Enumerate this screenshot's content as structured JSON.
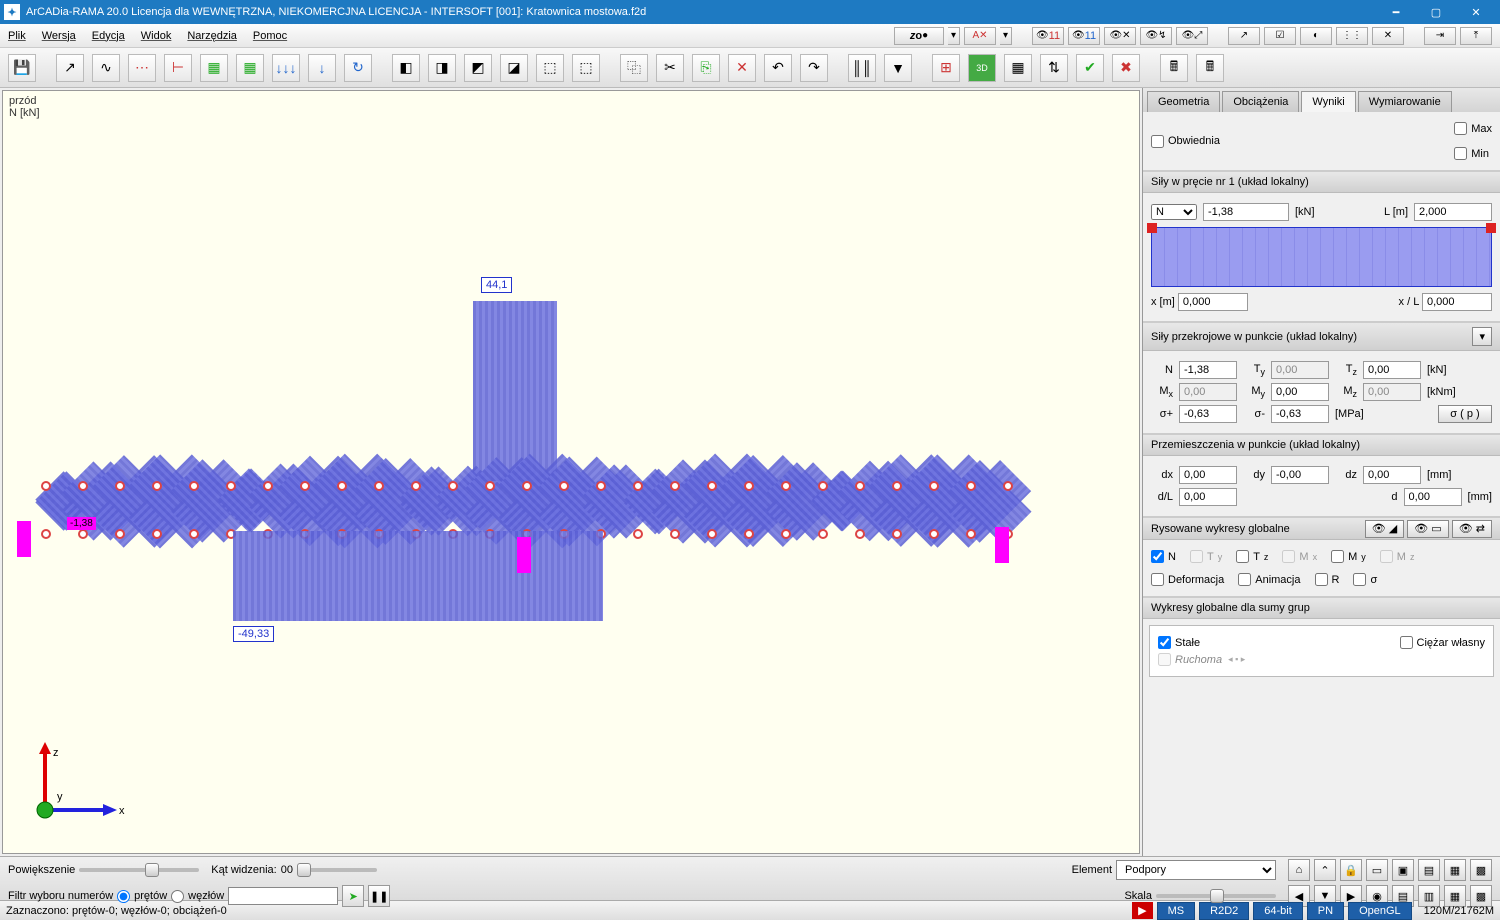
{
  "title": "ArCADia-RAMA 20.0 Licencja dla WEWNĘTRZNA, NIEKOMERCJNA LICENCJA - INTERSOFT [001]: Kratownica mostowa.f2d",
  "menu": [
    "Plik",
    "Wersja",
    "Edycja",
    "Widok",
    "Narzędzia",
    "Pomoc"
  ],
  "canvas": {
    "corner": "przód",
    "unit": "N [kN]",
    "val_top": "44,1",
    "val_bot": "-49,33",
    "val_sel": "-1,38",
    "axis_x": "x",
    "axis_y": "y",
    "axis_z": "z"
  },
  "tabs": {
    "geom": "Geometria",
    "loads": "Obciążenia",
    "results": "Wyniki",
    "dim": "Wymiarowanie"
  },
  "env": {
    "label": "Obwiednia",
    "max": "Max",
    "min": "Min"
  },
  "sec_forces": {
    "title": "Siły w pręcie nr 1 (układ lokalny)",
    "force_sel": "N",
    "force_val": "-1,38",
    "force_unit": "[kN]",
    "L_lbl": "L [m]",
    "L_val": "2,000",
    "x_lbl": "x [m]",
    "x_val": "0,000",
    "xL_lbl": "x / L",
    "xL_val": "0,000"
  },
  "sec_point": {
    "title": "Siły przekrojowe w punkcie (układ lokalny)",
    "N": "-1,38",
    "Ty": "0,00",
    "Tz": "0,00",
    "Mx": "0,00",
    "My": "0,00",
    "Mz": "0,00",
    "sp": "-0,63",
    "sm": "-0,63",
    "u_kN": "[kN]",
    "u_kNm": "[kNm]",
    "u_MPa": "[MPa]",
    "btn": "σ ( p )"
  },
  "sec_disp": {
    "title": "Przemieszczenia w punkcie (układ lokalny)",
    "dx": "0,00",
    "dy": "-0,00",
    "dz": "0,00",
    "dL": "0,00",
    "d": "0,00",
    "u": "[mm]"
  },
  "sec_diag": {
    "title": "Rysowane wykresy globalne",
    "N": "N",
    "Ty": "Ty",
    "Tz": "Tz",
    "Mx": "Mx",
    "My": "My",
    "Mz": "Mz",
    "def": "Deformacja",
    "anim": "Animacja",
    "R": "R",
    "sig": "σ"
  },
  "sec_global": {
    "title": "Wykresy globalne dla sumy grup",
    "stale": "Stałe",
    "ciezar": "Ciężar własny",
    "ruchoma": "Ruchoma"
  },
  "bottom": {
    "zoom": "Powiększenie",
    "fov_lbl": "Kąt widzenia:",
    "fov_val": "00",
    "filter": "Filtr wyboru numerów",
    "bars": "prętów",
    "nodes": "węzłów",
    "elem": "Element",
    "elem_val": "Podpory",
    "scale": "Skala"
  },
  "status": {
    "sel": "Zaznaczono: prętów-0; węzłów-0; obciążeń-0",
    "ms": "MS",
    "r2": "R2D2",
    "bit": "64-bit",
    "pn": "PN",
    "gl": "OpenGL",
    "mem": "120M/21762M"
  }
}
